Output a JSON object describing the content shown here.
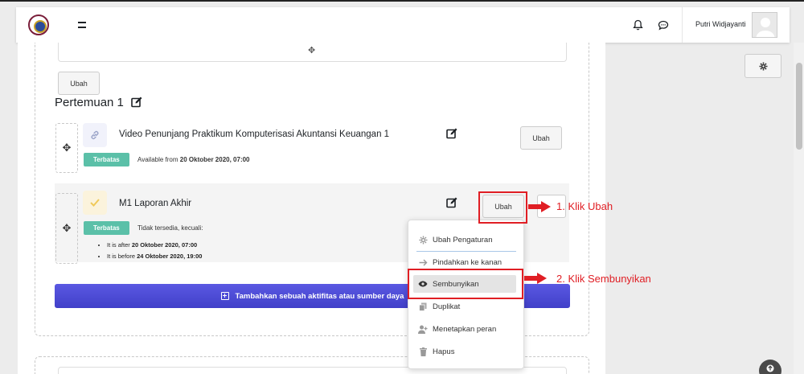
{
  "topbar": {
    "username": "Putri Widjayanti",
    "icons": [
      "site-logo",
      "menu-toggle-icon",
      "bell-icon",
      "chat-icon",
      "avatar"
    ]
  },
  "section": {
    "top_edit_label": "Ubah",
    "title": "Pertemuan 1"
  },
  "activities": [
    {
      "name": "Video Penunjang Praktikum Komputerisasi Akuntansi Keuangan 1",
      "icon": "link-icon",
      "badge": "Terbatas",
      "restriction_prefix": "Available from",
      "restriction_date": "20 Oktober 2020, 07:00",
      "edit_label": "Ubah"
    },
    {
      "name": "M1 Laporan Akhir",
      "icon": "assignment-check-icon",
      "badge": "Terbatas",
      "restriction_prefix": "Tidak tersedia, kecuali:",
      "conditions": [
        {
          "prefix": "It is after",
          "date": "20 Oktober 2020, 07:00"
        },
        {
          "prefix": "It is before",
          "date": "24 Oktober 2020, 19:00"
        }
      ],
      "edit_label": "Ubah"
    }
  ],
  "add_activity_label": "Tambahkan sebuah aktifitas atau sumber daya",
  "menu": {
    "items": [
      {
        "label": "Ubah Pengaturan",
        "icon": "gear-icon"
      },
      {
        "label": "Pindahkan ke kanan",
        "icon": "arrow-right-icon"
      },
      {
        "label": "Sembunyikan",
        "icon": "eye-icon"
      },
      {
        "label": "Duplikat",
        "icon": "copy-icon"
      },
      {
        "label": "Menetapkan peran",
        "icon": "user-role-icon"
      },
      {
        "label": "Hapus",
        "icon": "trash-icon"
      }
    ]
  },
  "annotations": {
    "step1": "1. Klik Ubah",
    "step2": "2. Klik Sembunyikan",
    "color": "#e01e24"
  },
  "colors": {
    "badge": "#5bc0a8",
    "primary_button": "#4a49d6"
  }
}
